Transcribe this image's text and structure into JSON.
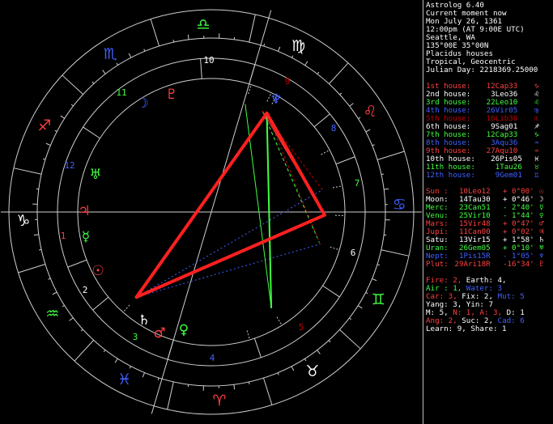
{
  "header": [
    "Astrolog 6.40",
    "Current moment now",
    "Mon July 26, 1361",
    "12:00pm (AT 9:00E UTC)",
    "Seattle, WA",
    "135°00E 35°00N",
    "Placidus houses",
    "Tropical, Geocentric",
    "Julian Day: 2218369.25000"
  ],
  "houses": [
    {
      "label": "1st house:",
      "value": "12Cap33",
      "sign": "♑",
      "color": "#ff4040"
    },
    {
      "label": "2nd house:",
      "value": "3Leo36",
      "sign": "♌",
      "color": "#ffffff"
    },
    {
      "label": "3rd house:",
      "value": "22Leo10",
      "sign": "♌",
      "color": "#40ff40"
    },
    {
      "label": "4th house:",
      "value": "26Vir05",
      "sign": "♍",
      "color": "#4060ff"
    },
    {
      "label": "5th house:",
      "value": "16Lib36",
      "sign": "♏",
      "color": "#c00000"
    },
    {
      "label": "6th house:",
      "value": "9Sag01",
      "sign": "♐",
      "color": "#ffffff"
    },
    {
      "label": "7th house:",
      "value": "12Cap33",
      "sign": "♑",
      "color": "#40ff40"
    },
    {
      "label": "8th house:",
      "value": "3Aqu36",
      "sign": "♒",
      "color": "#4060ff"
    },
    {
      "label": "9th house:",
      "value": "27Aqu10",
      "sign": "♒",
      "color": "#ff4040"
    },
    {
      "label": "10th house:",
      "value": "26Pis05",
      "sign": "♓",
      "color": "#ffffff"
    },
    {
      "label": "11th house:",
      "value": "1Tau26",
      "sign": "♉",
      "color": "#40ff40"
    },
    {
      "label": "12th house:",
      "value": "9Gem01",
      "sign": "♊",
      "color": "#4060ff"
    }
  ],
  "planets": [
    {
      "name": "Sun :",
      "pos": "10Leo12",
      "speed": "+ 0°00'",
      "sign": "☉",
      "color": "#ff4040"
    },
    {
      "name": "Moon:",
      "pos": "14Tau30",
      "speed": "+ 0°46'",
      "sign": "☽",
      "color": "#ffffff"
    },
    {
      "name": "Merc:",
      "pos": "23Can51",
      "speed": "- 2°40'",
      "sign": "☿",
      "color": "#40ff40"
    },
    {
      "name": "Venu:",
      "pos": "25Vir10",
      "speed": "- 1°44'",
      "sign": "♀",
      "color": "#40ff40"
    },
    {
      "name": "Mars:",
      "pos": "15Vir48",
      "speed": "+ 0°47'",
      "sign": "♂",
      "color": "#ff4040"
    },
    {
      "name": "Jupi:",
      "pos": "11Can00",
      "speed": "+ 0°02'",
      "sign": "♃",
      "color": "#ff4040"
    },
    {
      "name": "Satu:",
      "pos": "13Vir15",
      "speed": "+ 1°58'",
      "sign": "♄",
      "color": "#ffffff"
    },
    {
      "name": "Uran:",
      "pos": "26Gem05",
      "speed": "+ 0°10'",
      "sign": "♅",
      "color": "#40ff40"
    },
    {
      "name": "Nept:",
      "pos": "1Pis15R",
      "speed": "- 1°05'",
      "sign": "♆",
      "color": "#4060ff"
    },
    {
      "name": "Plut:",
      "pos": "29Ari18R",
      "speed": "-16°34'",
      "sign": "♇",
      "color": "#ff4040"
    }
  ],
  "elements": {
    "line1": [
      {
        "t": "Fire: 2, ",
        "c": "#ff4040"
      },
      {
        "t": "Earth: 4,",
        "c": "#ffffff"
      }
    ],
    "line2": [
      {
        "t": "Air : 1, ",
        "c": "#40ff40"
      },
      {
        "t": "Water: 3",
        "c": "#4060ff"
      }
    ],
    "line3": [
      {
        "t": "Car: 3, ",
        "c": "#ff4040"
      },
      {
        "t": "Fix: 2, ",
        "c": "#ffffff"
      },
      {
        "t": "Mut: 5",
        "c": "#4060ff"
      }
    ],
    "line4": [
      {
        "t": "Yang: 3, Yin: 7",
        "c": "#ffffff"
      }
    ],
    "line5": [
      {
        "t": "M: 5, ",
        "c": "#ffffff"
      },
      {
        "t": "N: 1, ",
        "c": "#ff4040"
      },
      {
        "t": "A: 3, ",
        "c": "#ff4040"
      },
      {
        "t": "D: 1",
        "c": "#ffffff"
      }
    ],
    "line6": [
      {
        "t": "Ang: 2, ",
        "c": "#ff4040"
      },
      {
        "t": "Suc: 2, ",
        "c": "#ffffff"
      },
      {
        "t": "Cad: 6",
        "c": "#4060ff"
      }
    ],
    "line7": [
      {
        "t": "Learn: 9, Share: 1",
        "c": "#ffffff"
      }
    ]
  },
  "wheel": {
    "house_numbers": [
      "1",
      "2",
      "3",
      "4",
      "5",
      "6",
      "7",
      "8",
      "9",
      "10",
      "11",
      "12"
    ],
    "house_number_colors": [
      "#ff4040",
      "#ffffff",
      "#40ff40",
      "#4060ff",
      "#c00000",
      "#ffffff",
      "#40ff40",
      "#4060ff",
      "#c00000",
      "#ffffff",
      "#40ff40",
      "#4060ff"
    ],
    "signs": [
      {
        "glyph": "♈",
        "color": "#ff4040"
      },
      {
        "glyph": "♉",
        "color": "#ffffff"
      },
      {
        "glyph": "♊",
        "color": "#40ff40"
      },
      {
        "glyph": "♋",
        "color": "#4060ff"
      },
      {
        "glyph": "♌",
        "color": "#ff4040"
      },
      {
        "glyph": "♍",
        "color": "#ffffff"
      },
      {
        "glyph": "♎",
        "color": "#40ff40"
      },
      {
        "glyph": "♏",
        "color": "#4060ff"
      },
      {
        "glyph": "♐",
        "color": "#ff4040"
      },
      {
        "glyph": "♑",
        "color": "#ffffff"
      },
      {
        "glyph": "♒",
        "color": "#40ff40"
      },
      {
        "glyph": "♓",
        "color": "#4060ff"
      }
    ],
    "planets": [
      {
        "glyph": "☉",
        "lon": 130.2,
        "color": "#ff4040"
      },
      {
        "glyph": "☽",
        "lon": 44.5,
        "color": "#4060ff"
      },
      {
        "glyph": "☿",
        "lon": 113.85,
        "color": "#40ff40"
      },
      {
        "glyph": "♀",
        "lon": 175.17,
        "color": "#40ff40"
      },
      {
        "glyph": "♂",
        "lon": 165.8,
        "color": "#ff4040"
      },
      {
        "glyph": "♃",
        "lon": 101.0,
        "color": "#ff4040"
      },
      {
        "glyph": "♄",
        "lon": 163.25,
        "color": "#ffffff"
      },
      {
        "glyph": "♅",
        "lon": 86.08,
        "color": "#40ff40"
      },
      {
        "glyph": "♆",
        "lon": 331.25,
        "color": "#4060ff"
      },
      {
        "glyph": "♇",
        "lon": 29.3,
        "color": "#ff4040"
      }
    ]
  }
}
